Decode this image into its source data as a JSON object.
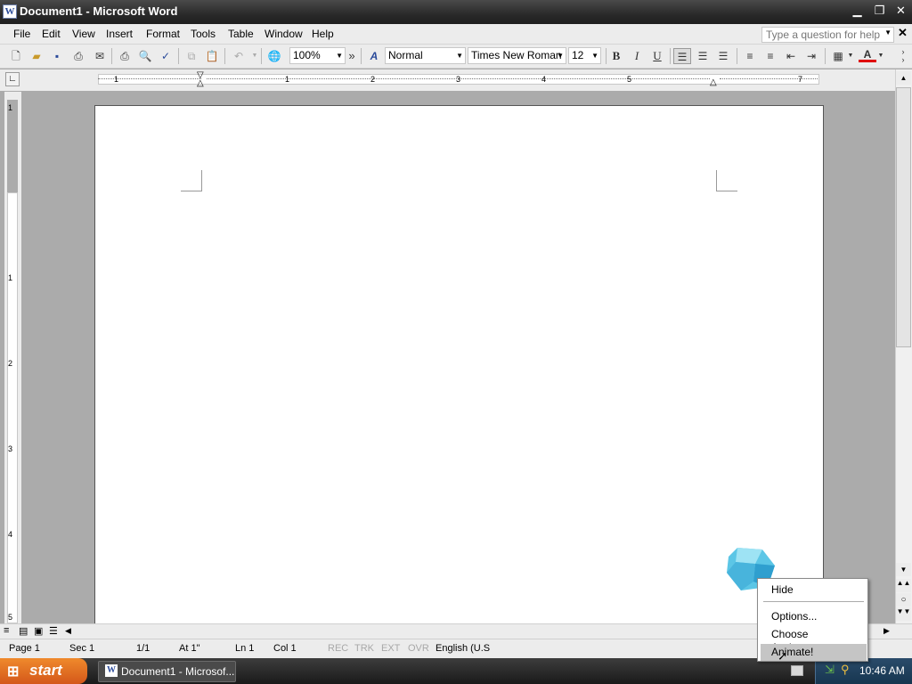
{
  "window": {
    "title": "Document1 - Microsoft Word",
    "app_icon_letter": "W"
  },
  "menu": [
    "File",
    "Edit",
    "View",
    "Insert",
    "Format",
    "Tools",
    "Table",
    "Window",
    "Help"
  ],
  "help_box": {
    "placeholder": "Type a question for help"
  },
  "toolbar": {
    "zoom": "100%",
    "style": "Normal",
    "font": "Times New Roman",
    "size": "12",
    "bold": "B",
    "italic": "I",
    "underline": "U",
    "overflow": "»"
  },
  "ruler": {
    "h_numbers": [
      "1",
      "1",
      "2",
      "3",
      "4",
      "5",
      "6",
      "7"
    ],
    "v_numbers": [
      "1",
      "1",
      "2",
      "3",
      "4",
      "5"
    ]
  },
  "status": {
    "page": "Page 1",
    "sec": "Sec 1",
    "pages": "1/1",
    "at": "At 1\"",
    "ln": "Ln 1",
    "col": "Col 1",
    "rec": "REC",
    "trk": "TRK",
    "ext": "EXT",
    "ovr": "OVR",
    "language": "English (U.S"
  },
  "taskbar": {
    "start_label": "start",
    "task": "Document1 - Microsof...",
    "clock": "10:46 AM"
  },
  "context_menu": {
    "hide": "Hide",
    "options": "Options...",
    "choose": "Choose Assistant...",
    "animate": "Animate!"
  },
  "colors": {
    "titlebar": "#2e2e2e",
    "start": "#e0702a",
    "menu_highlight": "#c5c5c5",
    "font_color_swatch": "#e00000"
  }
}
